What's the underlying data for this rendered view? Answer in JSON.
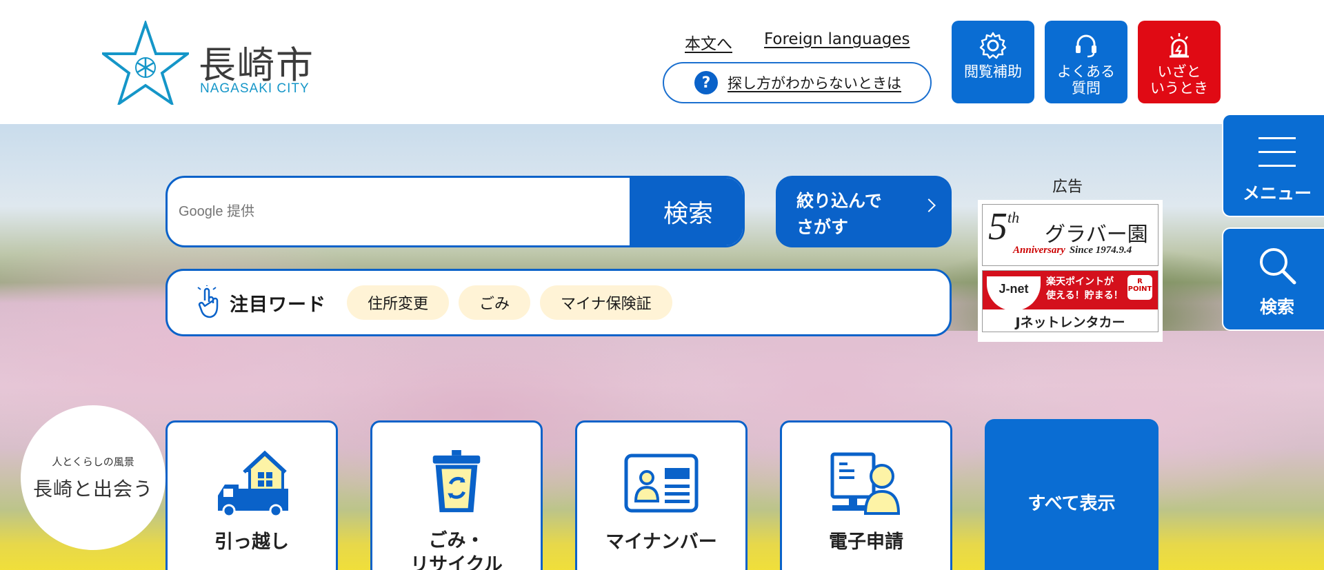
{
  "header": {
    "logo": {
      "kanji": "長崎市",
      "english": "NAGASAKI CITY"
    },
    "links": {
      "honbun": "本文へ",
      "foreign": "Foreign languages"
    },
    "help": {
      "icon": "question-icon",
      "label": "探し方がわからないときは"
    },
    "buttons": [
      {
        "label": "閲覧補助",
        "icon": "gear-icon"
      },
      {
        "label": "よくある\n質問",
        "icon": "headset-icon"
      },
      {
        "label": "いざと\nいうとき",
        "icon": "siren-icon"
      }
    ]
  },
  "search": {
    "placeholder": "Google 提供",
    "button": "検索"
  },
  "filter": {
    "label": "絞り込んで\nさがす"
  },
  "ad": {
    "label": "広告",
    "glover": {
      "five": "5",
      "th": "th",
      "name": "グラバー園",
      "anniv": "Anniversary",
      "since": "Since 1974.9.4"
    },
    "jnet": {
      "logo": "J-net",
      "promo": "楽天ポイントが\n使える！貯まる！",
      "point": "R\nPOINT",
      "name": "Jネットレンタカー"
    }
  },
  "keywords": {
    "title": "注目ワード",
    "items": [
      "住所変更",
      "ごみ",
      "マイナ保険証"
    ]
  },
  "banner": {
    "sub": "人とくらしの風景",
    "main": "長崎と出会う"
  },
  "categories": [
    {
      "label": "引っ越し",
      "icon": "moving-truck-icon"
    },
    {
      "label": "ごみ・\nリサイクル",
      "icon": "recycle-bin-icon"
    },
    {
      "label": "マイナンバー",
      "icon": "id-card-icon"
    },
    {
      "label": "電子申請",
      "icon": "computer-user-icon"
    }
  ],
  "show_all": "すべて表示",
  "side": {
    "menu": "メニュー",
    "search": "検索"
  },
  "colors": {
    "primary": "#0a62c9",
    "emergency": "#e00a14",
    "chip": "#fff3d6",
    "logo": "#1596c8"
  }
}
